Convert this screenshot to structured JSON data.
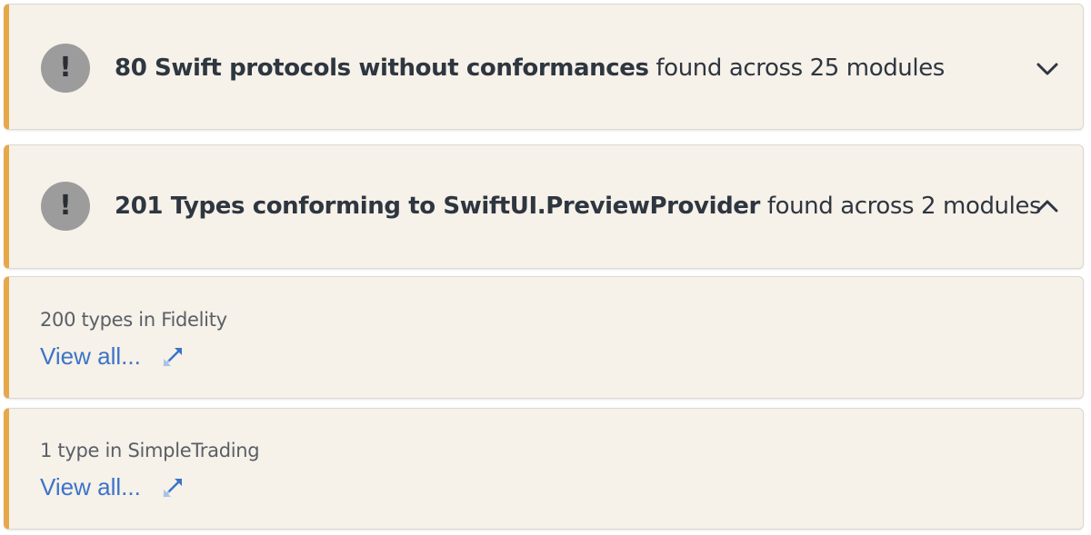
{
  "sections": [
    {
      "count_label": "80 Swift protocols without conformances",
      "suffix": " found across 25 modules",
      "state": "collapsed",
      "icon": "warning-exclamation-icon",
      "toggle_icon": "chevron-down-icon"
    },
    {
      "count_label": "201 Types conforming to SwiftUI.PreviewProvider",
      "suffix": " found across 2 modules",
      "state": "expanded",
      "icon": "warning-exclamation-icon",
      "toggle_icon": "chevron-up-icon",
      "details": [
        {
          "text": "200 types in Fidelity",
          "link": "View all...",
          "link_icon": "expand-arrows-icon"
        },
        {
          "text": "1 type in SimpleTrading",
          "link": "View all...",
          "link_icon": "expand-arrows-icon"
        }
      ]
    }
  ],
  "icon_glyph": "!",
  "colors": {
    "card_bg": "#f6f1e9",
    "accent": "#e5a84a",
    "link": "#3b74c9",
    "icon_bg": "#9c9c9c",
    "heading": "#2e3640"
  }
}
